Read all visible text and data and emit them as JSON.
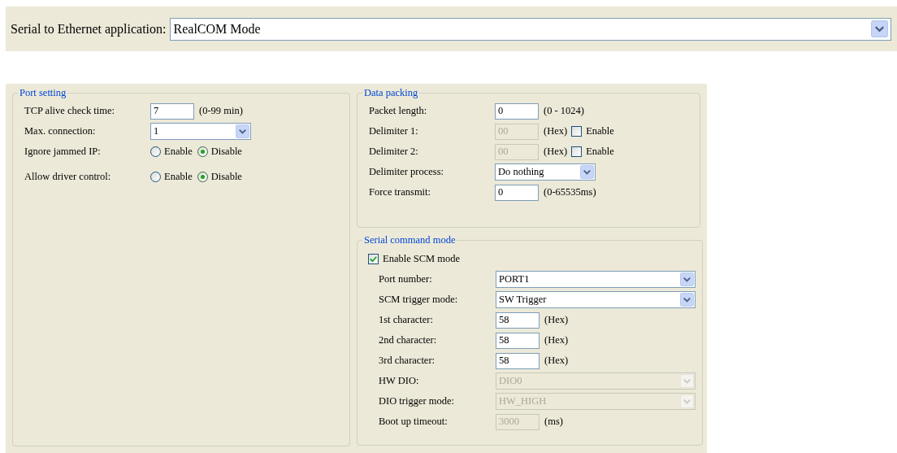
{
  "application": {
    "label": "Serial to Ethernet application:",
    "value": "RealCOM Mode"
  },
  "port_setting": {
    "title": "Port setting",
    "rows": [
      {
        "label": "TCP alive check time:",
        "kind": "text",
        "value": "7",
        "disabled": false,
        "suffix": "(0-99 min)"
      },
      {
        "label": "Max. connection:",
        "kind": "select",
        "value": "1",
        "disabled": false
      },
      {
        "label": "Ignore jammed IP:",
        "kind": "radio",
        "options": [
          {
            "label": "Enable",
            "selected": false
          },
          {
            "label": "Disable",
            "selected": true
          }
        ]
      },
      {
        "label": "Allow driver control:",
        "kind": "radio",
        "options": [
          {
            "label": "Enable",
            "selected": false
          },
          {
            "label": "Disable",
            "selected": true
          }
        ]
      }
    ]
  },
  "data_packing": {
    "title": "Data packing",
    "rows": [
      {
        "label": "Packet length:",
        "kind": "text",
        "value": "0",
        "disabled": false,
        "suffix": "(0 - 1024)"
      },
      {
        "label": "Delimiter 1:",
        "kind": "text",
        "value": "00",
        "disabled": true,
        "suffix": "(Hex)",
        "check": {
          "label": "Enable",
          "checked": false
        }
      },
      {
        "label": "Delimiter 2:",
        "kind": "text",
        "value": "00",
        "disabled": true,
        "suffix": "(Hex)",
        "check": {
          "label": "Enable",
          "checked": false
        }
      },
      {
        "label": "Delimiter process:",
        "kind": "select",
        "value": "Do nothing",
        "disabled": false
      },
      {
        "label": "Force transmit:",
        "kind": "text",
        "value": "0",
        "disabled": false,
        "suffix": "(0-65535ms)"
      }
    ]
  },
  "serial_command_mode": {
    "title": "Serial command mode",
    "enable": {
      "label": "Enable SCM mode",
      "checked": true
    },
    "rows": [
      {
        "label": "Port number:",
        "kind": "wide-select",
        "value": "PORT1",
        "disabled": false
      },
      {
        "label": "SCM trigger mode:",
        "kind": "wide-select",
        "value": "SW Trigger",
        "disabled": false
      },
      {
        "label": "1st character:",
        "kind": "text",
        "value": "58",
        "disabled": false,
        "suffix": "(Hex)"
      },
      {
        "label": "2nd character:",
        "kind": "text",
        "value": "58",
        "disabled": false,
        "suffix": "(Hex)"
      },
      {
        "label": "3rd character:",
        "kind": "text",
        "value": "58",
        "disabled": false,
        "suffix": "(Hex)"
      },
      {
        "label": "HW DIO:",
        "kind": "wide-select",
        "value": "DIO0",
        "disabled": true
      },
      {
        "label": "DIO trigger mode:",
        "kind": "wide-select",
        "value": "HW_HIGH",
        "disabled": true
      },
      {
        "label": "Boot up timeout:",
        "kind": "text",
        "value": "3000",
        "disabled": true,
        "suffix": "(ms)"
      }
    ]
  }
}
